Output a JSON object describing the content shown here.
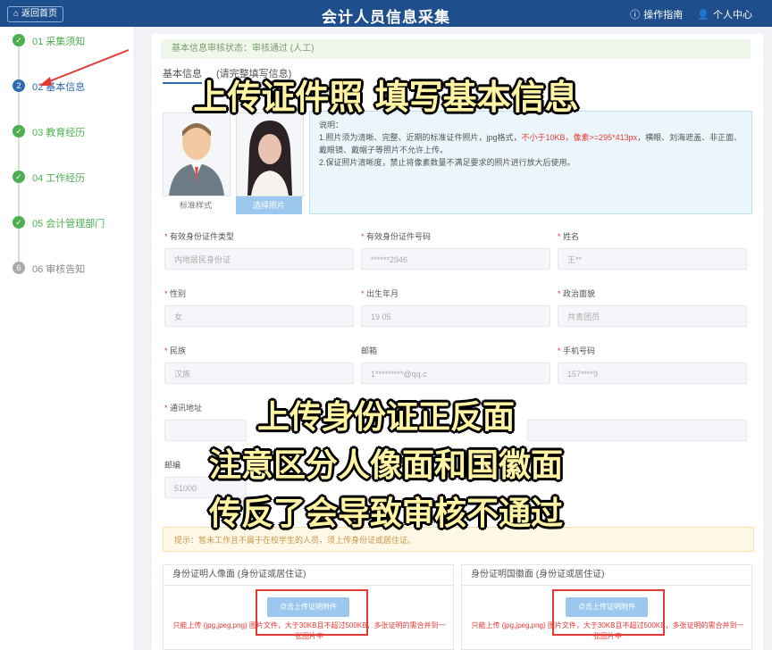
{
  "header": {
    "home_label": "返回首页",
    "title": "会计人员信息采集",
    "guide_label": "操作指南",
    "user_label": "个人中心"
  },
  "steps": [
    {
      "num": "✓",
      "label": "01 采集须知",
      "state": "done"
    },
    {
      "num": "2",
      "label": "02 基本信息",
      "state": "active"
    },
    {
      "num": "✓",
      "label": "03 教育经历",
      "state": "done"
    },
    {
      "num": "✓",
      "label": "04 工作经历",
      "state": "done"
    },
    {
      "num": "✓",
      "label": "05 会计管理部门",
      "state": "done"
    },
    {
      "num": "6",
      "label": "06 审核告知",
      "state": "pending"
    }
  ],
  "status": "基本信息审核状态：审核通过 (人工)",
  "tabs": [
    "基本信息",
    "(请完整填写信息)"
  ],
  "photos": {
    "sample_caption": "标准样式",
    "choose_button": "选择照片"
  },
  "notice": {
    "title": "说明：",
    "line1_a": "1.照片须为清晰、完整、近期的标准证件照片，jpg格式，",
    "line1_red": "不小于10KB，像素>=295*413px",
    "line1_b": "，横眼、刘海遮盖、非正面、戴眼镜、戴帽子等照片不允许上传。",
    "line2": "2.保证照片清晰度，禁止将像素数量不满足要求的照片进行放大后使用。"
  },
  "fields": {
    "id_type_label": "有效身份证件类型",
    "id_type_value": "内地居民身份证",
    "id_number_label": "有效身份证件号码",
    "id_number_value": "******2946",
    "name_label": "姓名",
    "name_value": "王**",
    "gender_label": "性别",
    "gender_value": "女",
    "birth_label": "出生年月",
    "birth_value": "19 05",
    "political_label": "政治面貌",
    "political_value": "共青团员",
    "ethnic_label": "民族",
    "ethnic_value": "汉族",
    "email_label": "邮箱",
    "email_value": "1*********@qq.c",
    "phone_label": "手机号码",
    "phone_value": "157****9",
    "address_label": "通讯地址",
    "postcode_label": "邮编",
    "postcode_value": "51000"
  },
  "warning": "提示：暂未工作且不属于在校学生的人员，须上传身份证或居住证。",
  "uploads": {
    "front_title": "身份证明人像面 (身份证或居住证)",
    "back_title": "身份证明国徽面 (身份证或居住证)",
    "button_label": "点击上传证明附件",
    "note": "只能上传 (jpg,jpeg,png) 图片文件，大于30KB且不超过500KB，多张证明的需合并到一张图片中"
  },
  "overlay": {
    "line1": "上传证件照 填写基本信息",
    "line2": "上传身份证正反面",
    "line3": "注意区分人像面和国徽面",
    "line4": "传反了会导致审核不通过"
  },
  "colors": {
    "header_bg": "#1f4e8c",
    "accent": "#2b6cb0",
    "done_green": "#4caf50",
    "alert_red": "#e53935",
    "overlay_text": "#fff4a3"
  }
}
